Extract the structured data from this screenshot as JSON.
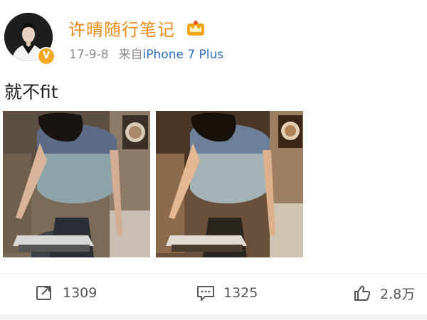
{
  "author": {
    "name": "许晴随行笔记",
    "verified_badge": "V",
    "avatar_icon": "avatar-portrait",
    "vip_icon": "crown-badge-icon"
  },
  "meta": {
    "date": "17-9-8",
    "source_prefix": "来自",
    "source_device": "iPhone 7 Plus"
  },
  "post": {
    "text": "就不fit",
    "images": [
      "photo-1",
      "photo-2"
    ]
  },
  "actions": {
    "repost_count": "1309",
    "comment_count": "1325",
    "like_count": "2.8万"
  },
  "colors": {
    "username": "#ee8a1a",
    "link": "#2f6fbf",
    "meta_gray": "#8a8a8a",
    "badge": "#f5a623"
  }
}
